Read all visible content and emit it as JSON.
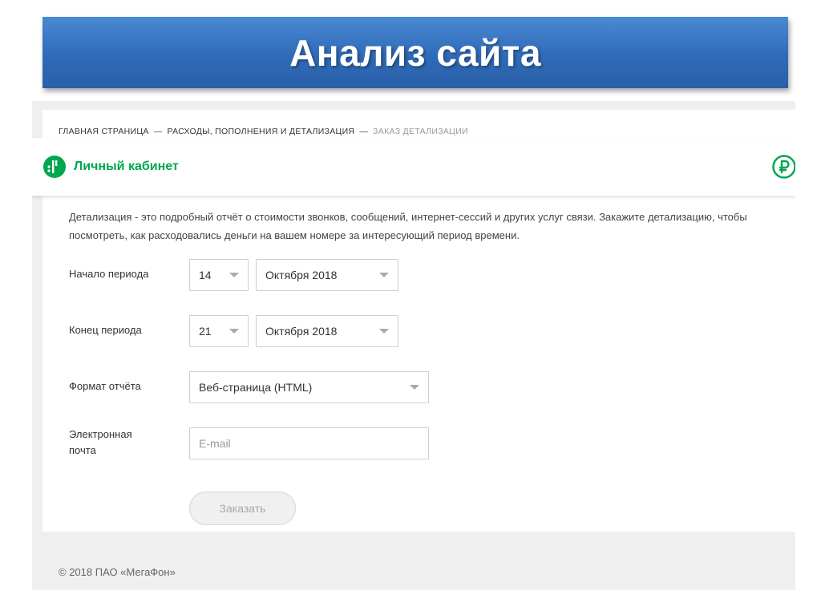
{
  "slide": {
    "title": "Анализ сайта"
  },
  "breadcrumb": {
    "items": [
      "Главная страница",
      "Расходы, пополнения и детализация"
    ],
    "separator": "—",
    "current": "Заказ детализации"
  },
  "header": {
    "logo_text": "Личный кабинет",
    "brand_color": "#00a650",
    "logo_icon": "megafon-logo-icon",
    "right_icon": "ruble-icon"
  },
  "description": "Детализация - это подробный отчёт о стоимости звонков, сообщений, интернет-сессий и других услуг связи. Закажите детализацию, чтобы посмотреть, как расходовались деньги на вашем номере за интересующий период времени.",
  "form": {
    "start": {
      "label": "Начало периода",
      "day": "14",
      "month": "Октября 2018"
    },
    "end": {
      "label": "Конец периода",
      "day": "21",
      "month": "Октября 2018"
    },
    "format": {
      "label": "Формат отчёта",
      "value": "Веб-страница (HTML)"
    },
    "email": {
      "label": "Электронная почта",
      "placeholder": "E-mail",
      "value": ""
    },
    "submit_label": "Заказать"
  },
  "footer": {
    "copyright": "© 2018 ПАО «МегаФон»"
  }
}
